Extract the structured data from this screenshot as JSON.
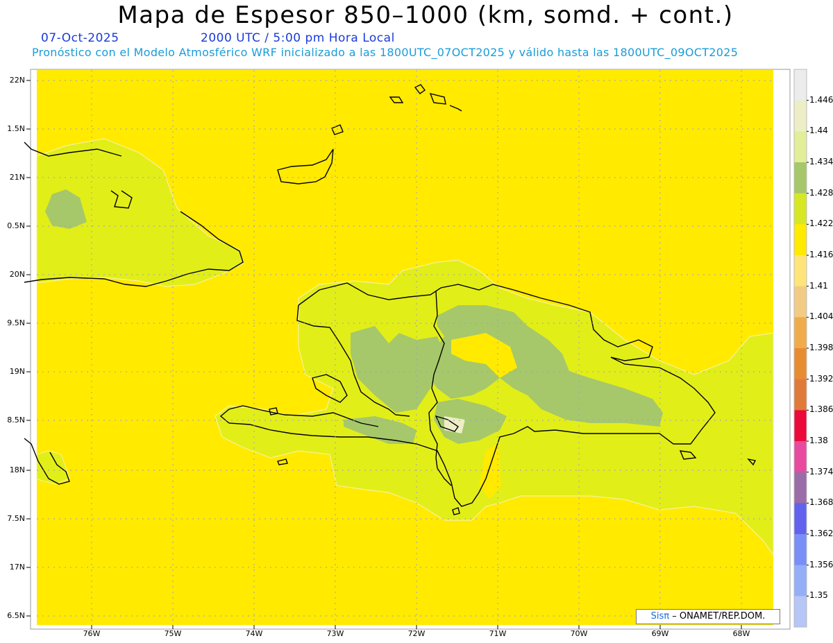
{
  "header": {
    "title": "Mapa de Espesor 850–1000 (km, somd. + cont.)",
    "date": "07-Oct-2025",
    "time": "2000 UTC / 5:00 pm Hora Local",
    "description": "Pronóstico con el Modelo Atmosférico WRF inicializado a las 1800UTC_07OCT2025 y válido hasta las  1800UTC_09OCT2025"
  },
  "axes": {
    "lat_labels": [
      "22N",
      "1.5N",
      "21N",
      "0.5N",
      "20N",
      "9.5N",
      "19N",
      "8.5N",
      "18N",
      "7.5N",
      "17N",
      "6.5N"
    ],
    "lon_labels": [
      "76W",
      "75W",
      "74W",
      "73W",
      "72W",
      "71W",
      "70W",
      "69W",
      "68W"
    ]
  },
  "colorbar": {
    "labels": [
      "1.446",
      "1.44",
      "1.434",
      "1.428",
      "1.422",
      "1.416",
      "1.41",
      "1.404",
      "1.398",
      "1.392",
      "1.386",
      "1.38",
      "1.374",
      "1.368",
      "1.362",
      "1.356",
      "1.35"
    ],
    "colors": [
      "#ececec",
      "#eeeec6",
      "#e2ee98",
      "#a6c86a",
      "#d6e824",
      "#ffea00",
      "#ffe47a",
      "#f2cc84",
      "#f0ac4a",
      "#e88c32",
      "#e07a3a",
      "#ec0a3a",
      "#e84aa0",
      "#9a6ca8",
      "#6262ee",
      "#7a8ef8",
      "#94aef8",
      "#b6c6f6"
    ]
  },
  "colors": {
    "sea": "#ffea00",
    "land": "#e2ee18",
    "land_dark": "#a6c86a",
    "coast": "#000000"
  },
  "credit": {
    "sis": "Sisπ",
    "text": "– ONAMET/REP.DOM."
  }
}
